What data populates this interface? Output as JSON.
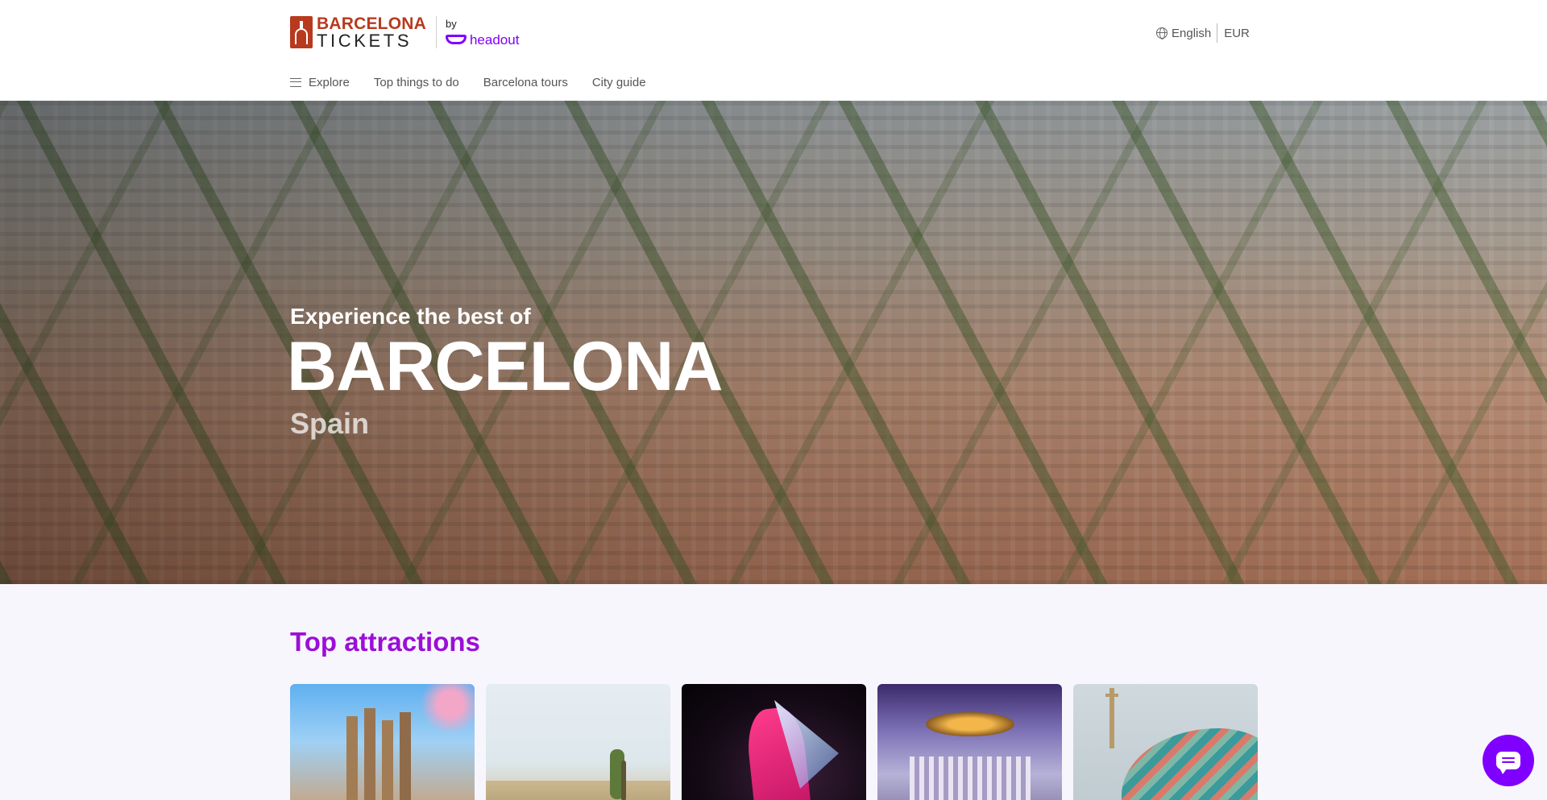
{
  "header": {
    "logo": {
      "line1": "BARCELONA",
      "line2": "TICKETS",
      "by": "by",
      "partner": "headout"
    },
    "language": "English",
    "currency": "EUR"
  },
  "nav": {
    "items": [
      {
        "label": "Explore"
      },
      {
        "label": "Top things to do"
      },
      {
        "label": "Barcelona tours"
      },
      {
        "label": "City guide"
      }
    ]
  },
  "hero": {
    "kicker": "Experience the best of",
    "title": "BARCELONA",
    "subtitle": "Spain"
  },
  "attractions": {
    "title": "Top attractions",
    "cards": [
      {
        "image": "sagrada-familia"
      },
      {
        "image": "park-guell"
      },
      {
        "image": "flamenco-show"
      },
      {
        "image": "palau-de-la-musica"
      },
      {
        "image": "casa-batllo"
      }
    ]
  },
  "chat": {
    "icon": "chat-icon"
  },
  "colors": {
    "brand": "#b83a1e",
    "accent": "#8000ff",
    "section_title": "#9b0fd6"
  }
}
